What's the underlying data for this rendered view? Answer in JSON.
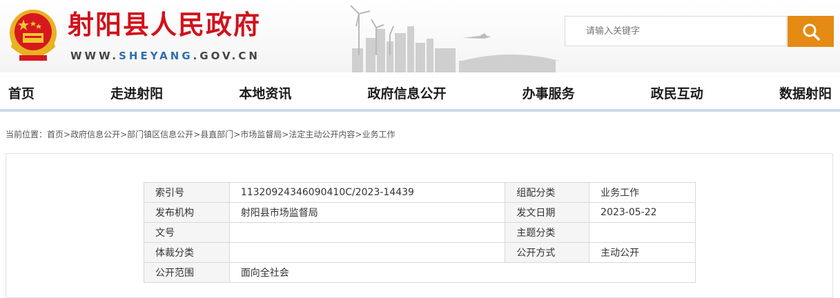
{
  "header": {
    "site_name": "射阳县人民政府",
    "domain_prefix": "WWW.",
    "domain_highlight": "SHEYANG",
    "domain_suffix": ".GOV.CN"
  },
  "search": {
    "placeholder": "请输入关键字"
  },
  "nav": {
    "items": [
      "首页",
      "走进射阳",
      "本地资讯",
      "政府信息公开",
      "办事服务",
      "政民互动",
      "数据射阳"
    ]
  },
  "breadcrumb": {
    "prefix": "当前位置：",
    "items": [
      "首页",
      "政府信息公开",
      "部门镇区信息公开",
      "县直部门",
      "市场监督局",
      "法定主动公开内容",
      "业务工作"
    ],
    "separator": ">"
  },
  "meta": {
    "index_label": "索引号",
    "index_value": "11320924346090410C/2023-14439",
    "category_label": "组配分类",
    "category_value": "业务工作",
    "publisher_label": "发布机构",
    "publisher_value": "射阳县市场监督局",
    "date_label": "发文日期",
    "date_value": "2023-05-22",
    "docno_label": "文号",
    "docno_value": "",
    "topic_label": "主题分类",
    "topic_value": "",
    "genre_label": "体裁分类",
    "genre_value": "",
    "mode_label": "公开方式",
    "mode_value": "主动公开",
    "scope_label": "公开范围",
    "scope_value": "面向全社会"
  },
  "colors": {
    "accent": "#d1121c",
    "search_button": "#e58a12",
    "nav_line": "#c9d9e8"
  },
  "icons": {
    "emblem": "national-emblem-icon",
    "search": "search-icon"
  }
}
